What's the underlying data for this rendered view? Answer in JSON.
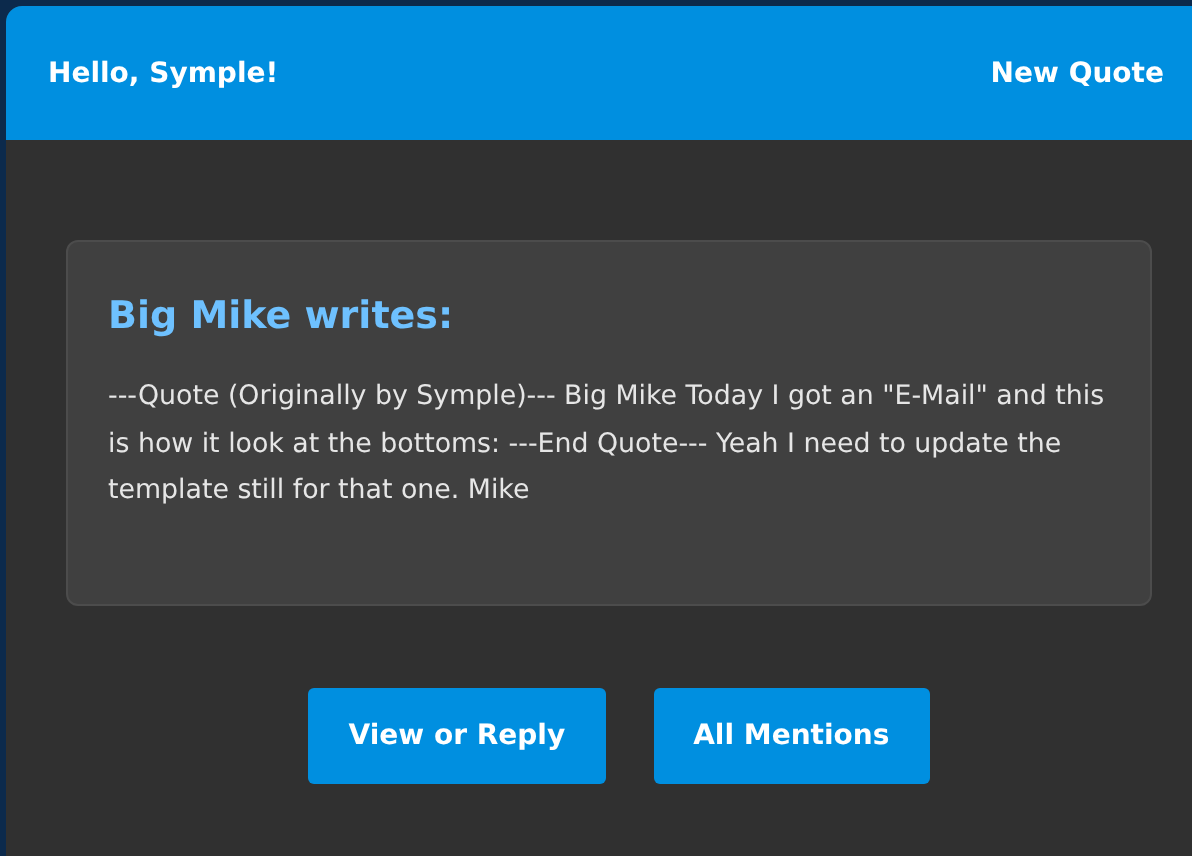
{
  "header": {
    "greeting": "Hello, Symple!",
    "title": "New Quote"
  },
  "quote": {
    "heading": "Big Mike writes:",
    "body": "---Quote (Originally by Symple)--- Big Mike Today I got an \"E-Mail\" and this is how it look at the bottoms: ---End Quote--- Yeah I need to update the template still for that one. Mike"
  },
  "buttons": [
    {
      "label": "View or Reply"
    },
    {
      "label": "All Mentions"
    }
  ]
}
